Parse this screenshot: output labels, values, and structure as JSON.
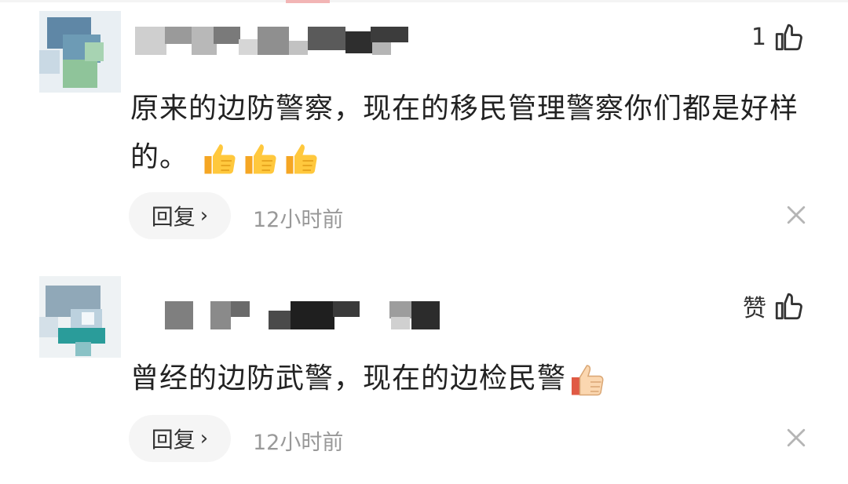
{
  "comments": [
    {
      "like_label": "1",
      "text": "原来的边防警察，现在的移民管理警察你们都是好样的。",
      "emoji": [
        "thumbs-up-yellow",
        "thumbs-up-yellow",
        "thumbs-up-yellow"
      ],
      "reply_label": "回复",
      "reply_chevron": "›",
      "time": "12小时前"
    },
    {
      "like_label": "赞",
      "text": "曾经的边防武警，现在的边检民警",
      "emoji": [
        "thumbs-up-light"
      ],
      "reply_label": "回复",
      "reply_chevron": "›",
      "time": "12小时前"
    }
  ],
  "colors": {
    "text": "#222222",
    "muted": "#999999",
    "reply_bg": "#f5f5f5"
  }
}
